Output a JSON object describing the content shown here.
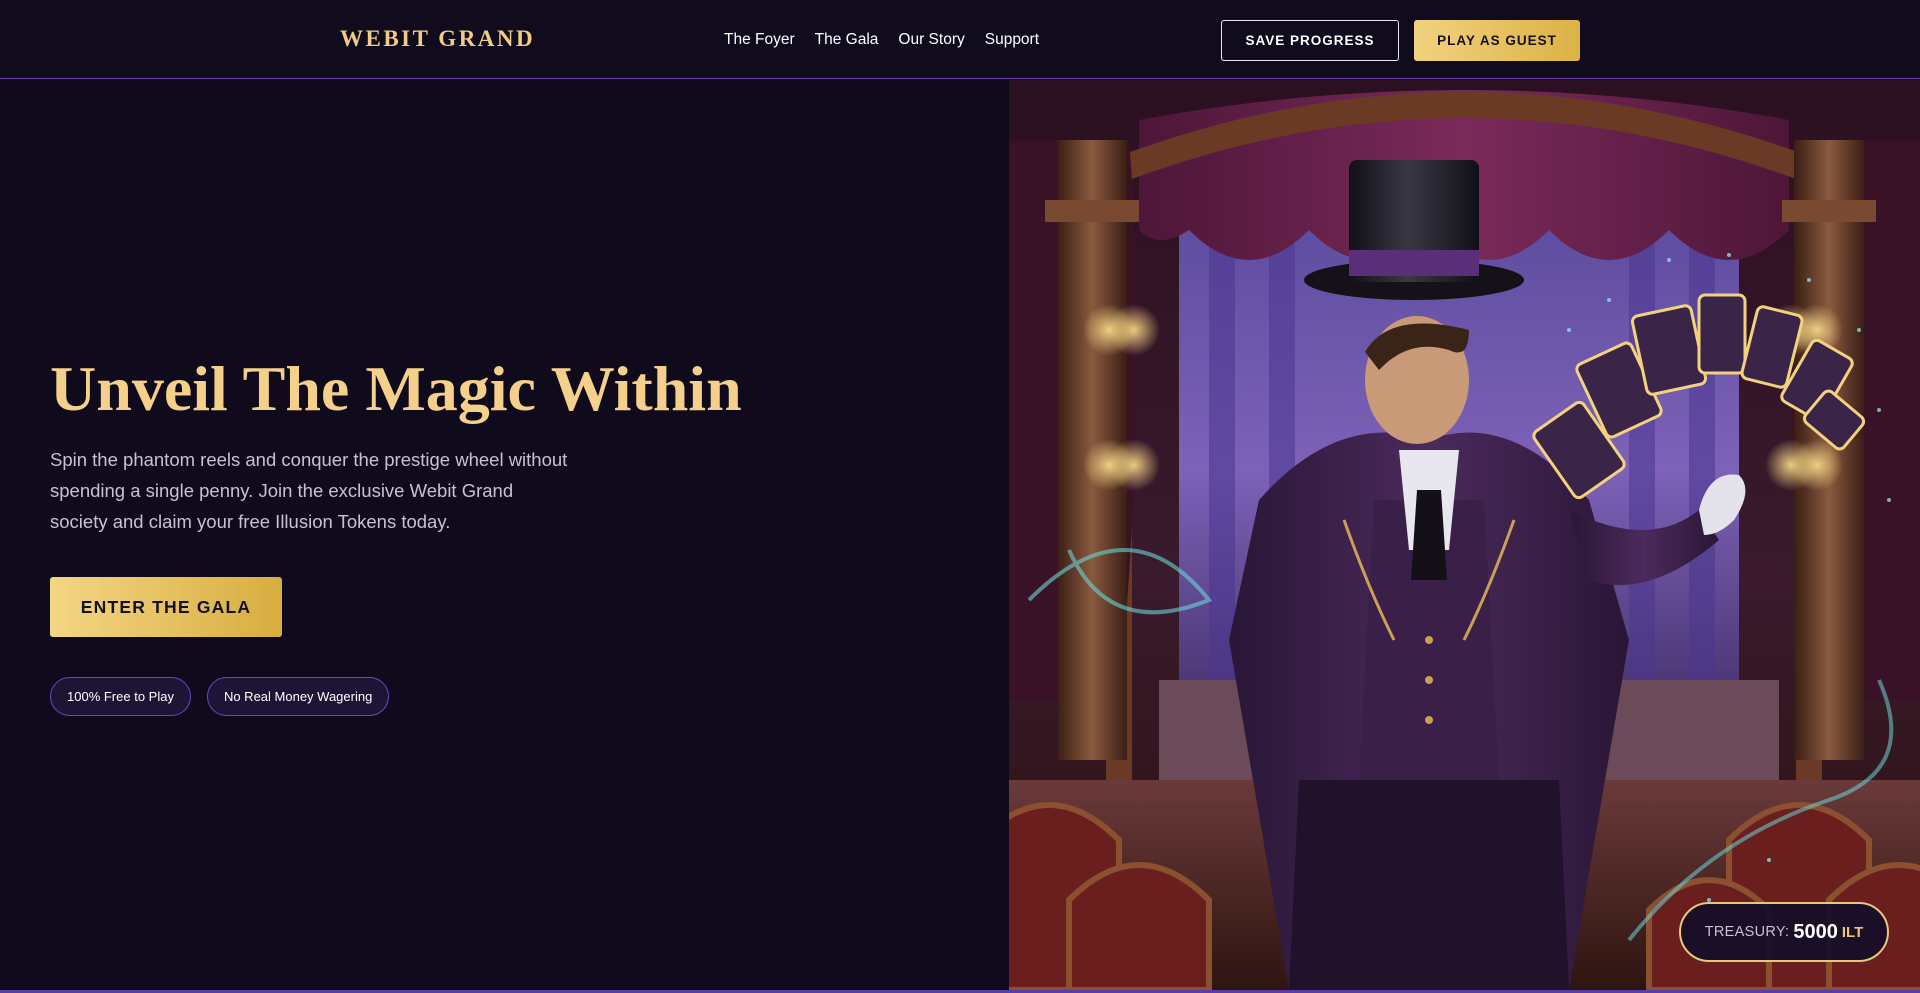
{
  "brand": {
    "name": "WEBIT GRAND"
  },
  "nav": {
    "items": [
      {
        "label": "The Foyer"
      },
      {
        "label": "The Gala"
      },
      {
        "label": "Our Story"
      },
      {
        "label": "Support"
      }
    ]
  },
  "header_actions": {
    "save_label": "SAVE PROGRESS",
    "guest_label": "PLAY AS GUEST"
  },
  "hero": {
    "title": "Unveil The Magic Within",
    "description": "Spin the phantom reels and conquer the prestige wheel without spending a single penny. Join the exclusive Webit Grand society and claim your free Illusion Tokens today.",
    "cta_label": "ENTER THE GALA",
    "badges": [
      {
        "label": "100% Free to Play"
      },
      {
        "label": "No Real Money Wagering"
      }
    ],
    "image_subject": "magician-in-top-hat-with-glowing-tarot-cards-on-theater-stage"
  },
  "treasury": {
    "label": "TREASURY:",
    "value": "5000",
    "unit": "ILT"
  },
  "colors": {
    "background": "#100a1d",
    "gold": "#f0cd82",
    "accent_purple": "#6b3fa8",
    "text_muted": "#c7c2d3"
  }
}
